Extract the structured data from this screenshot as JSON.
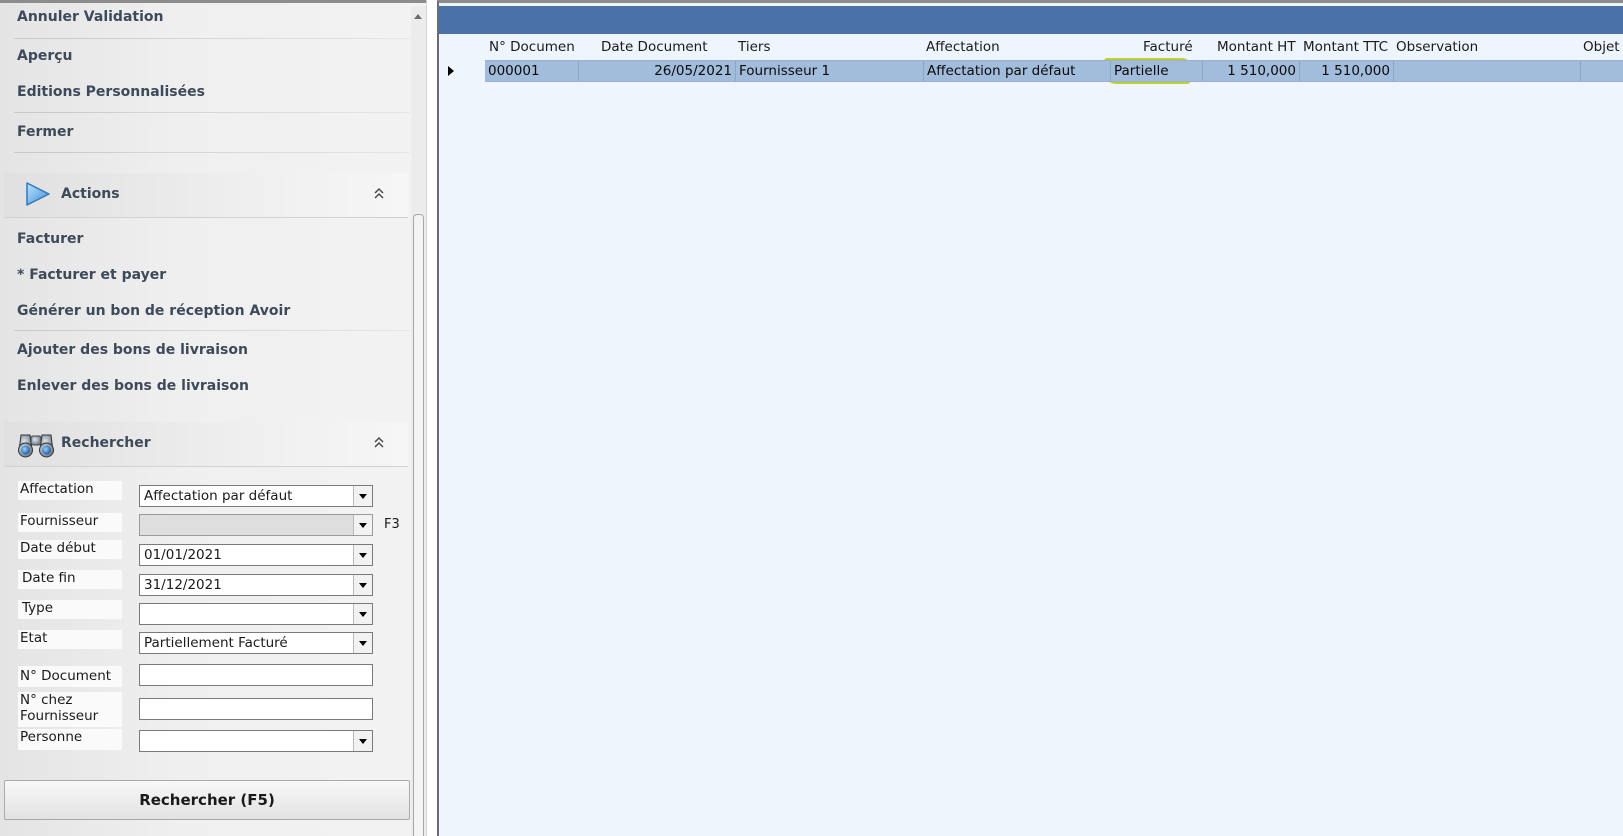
{
  "sidebar": {
    "links_top": [
      {
        "label": "Annuler Validation"
      },
      {
        "label": "Aperçu"
      },
      {
        "label": "Editions Personnalisées"
      },
      {
        "label": "Fermer"
      }
    ],
    "actions_section": {
      "title": "Actions",
      "items": [
        {
          "label": "Facturer"
        },
        {
          "label": "* Facturer et payer"
        },
        {
          "label": "Générer un bon de réception Avoir"
        },
        {
          "label": "Ajouter des bons de livraison"
        },
        {
          "label": "Enlever des bons de livraison"
        }
      ]
    },
    "search_section": {
      "title": "Rechercher",
      "fields": {
        "affectation": {
          "label": "Affectation",
          "value": "Affectation par défaut"
        },
        "fournisseur": {
          "label": "Fournisseur",
          "value": "",
          "hint": "F3"
        },
        "date_debut": {
          "label": "Date début",
          "value": "01/01/2021"
        },
        "date_fin": {
          "label": "Date fin",
          "value": "31/12/2021"
        },
        "type": {
          "label": "Type",
          "value": ""
        },
        "etat": {
          "label": "Etat",
          "value": "Partiellement Facturé"
        },
        "n_document": {
          "label": "N° Document",
          "value": ""
        },
        "n_chez_fournisseur": {
          "label_line1": "N° chez",
          "label_line2": "Fournisseur",
          "value": ""
        },
        "personne": {
          "label": "Personne",
          "value": ""
        }
      },
      "search_button": "Rechercher (F5)"
    }
  },
  "grid": {
    "columns": [
      "N° Documen",
      "Date Document",
      "Tiers",
      "Affectation",
      "Facturé",
      "Montant HT",
      "Montant TTC",
      "Observation",
      "Objet"
    ],
    "rows": [
      {
        "n_document": "000001",
        "date_document": "26/05/2021",
        "tiers": "Fournisseur 1",
        "affectation": "Affectation par défaut",
        "facture": "Partielle",
        "montant_ht": "1 510,000",
        "montant_ttc": "1 510,000",
        "observation": "",
        "objet": ""
      }
    ]
  },
  "colors": {
    "group_band": "#4a72a8",
    "selected_row": "#a2bddb",
    "grid_background": "#eef5fd",
    "highlight_marker": "#b8ce1a"
  },
  "icons": {
    "actions": "play-triangle-icon",
    "search": "binoculars-icon",
    "collapse": "double-chevron-up-icon"
  }
}
